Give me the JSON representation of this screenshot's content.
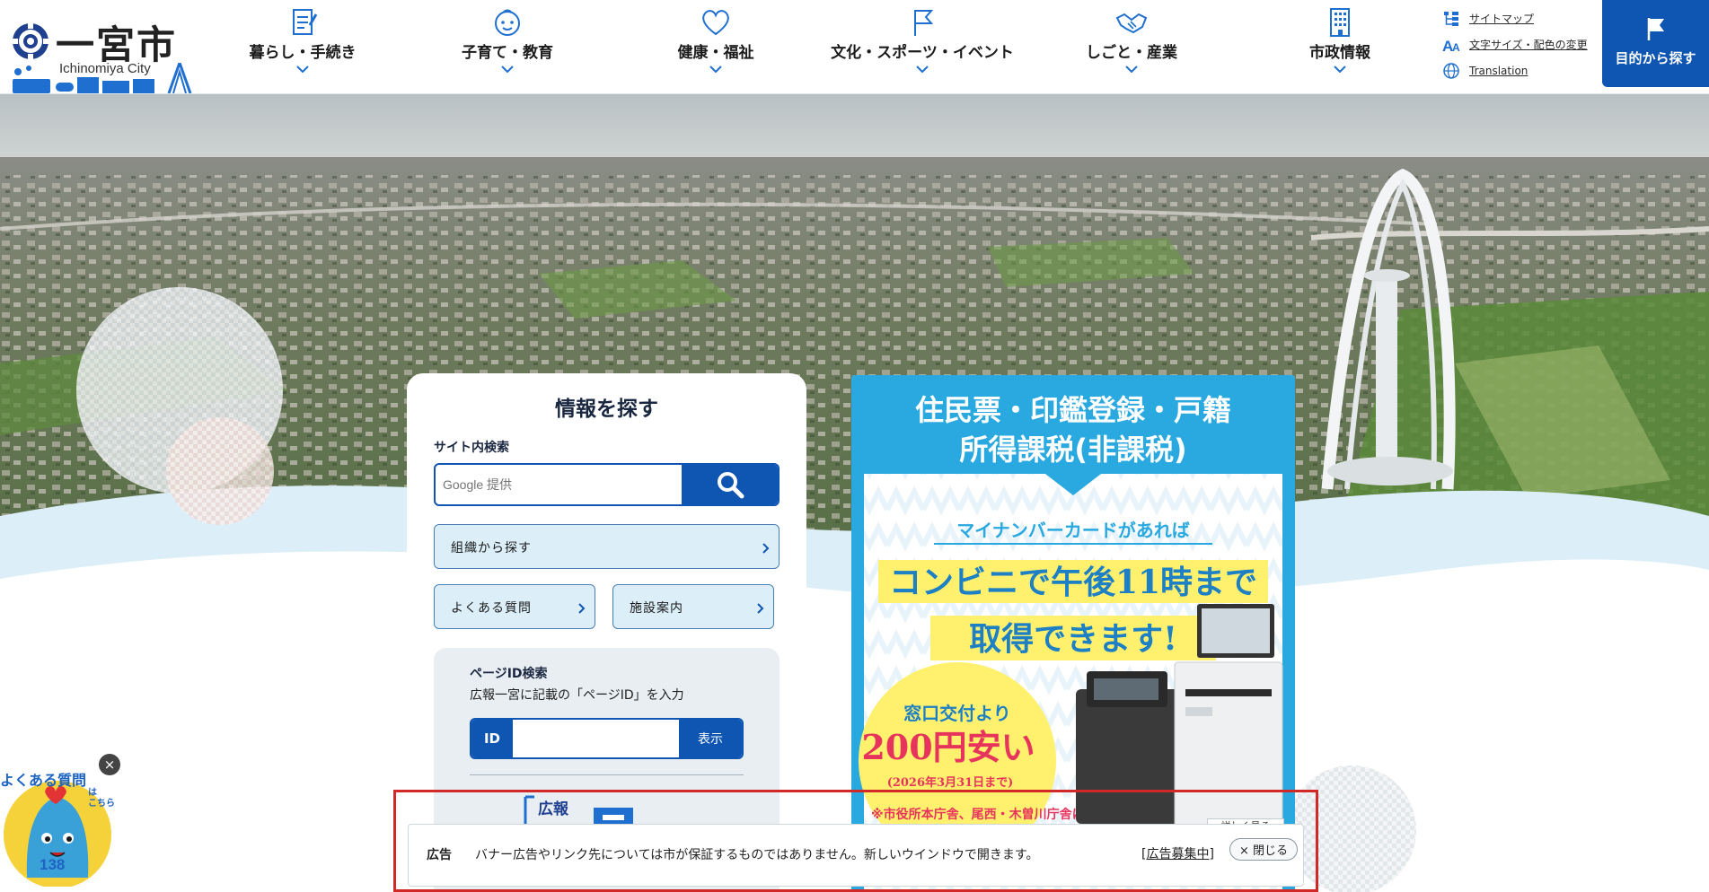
{
  "site": {
    "name": "一宮市",
    "name_en": "Ichinomiya City"
  },
  "nav": [
    {
      "label": "暮らし・手続き",
      "icon": "document-pen-icon"
    },
    {
      "label": "子育て・教育",
      "icon": "child-face-icon"
    },
    {
      "label": "健康・福祉",
      "icon": "heart-icon"
    },
    {
      "label": "文化・スポーツ・イベント",
      "icon": "flag-icon"
    },
    {
      "label": "しごと・産業",
      "icon": "handshake-icon"
    },
    {
      "label": "市政情報",
      "icon": "building-icon"
    }
  ],
  "utility": {
    "sitemap": "サイトマップ",
    "textsize": "文字サイズ・配色の変更",
    "translation": "Translation"
  },
  "purpose_button": "目的から探す",
  "search_panel": {
    "title": "情報を探す",
    "site_search_label": "サイト内検索",
    "search_placeholder": "Google 提供",
    "org_search": "組織から探す",
    "faq": "よくある質問",
    "facilities": "施設案内",
    "pageid": {
      "title": "ページID検索",
      "description": "広報一宮に記載の「ページID」を入力",
      "id_label": "ID",
      "show_button": "表示"
    },
    "koho_label": "広報"
  },
  "banner": {
    "line1": "住民票・印鑑登録・戸籍",
    "line2": "所得課税(非課税)",
    "line3": "マイナンバーカードがあれば",
    "line4": "コンビニで午後11時まで",
    "line5": "取得できます!",
    "line6": "窓口交付より",
    "line7": "200円安い",
    "line8": "(2026年3月31日まで)",
    "line9": "※市役所本庁舎、尾西・木曽川庁舎にも",
    "more": "詳しく見る"
  },
  "adbar": {
    "label": "広告",
    "text": "バナー広告やリンク先については市が保証するものではありません。新しいウインドウで開きます。",
    "recruit": "広告募集中",
    "close": "× 閉じる"
  },
  "mascot": {
    "text": "よくある質問",
    "text2": "は\nこちら",
    "number": "138"
  },
  "colors": {
    "brand_blue": "#0f56b3",
    "banner_sky": "#29a9e0",
    "banner_yellow": "#fff06e"
  }
}
